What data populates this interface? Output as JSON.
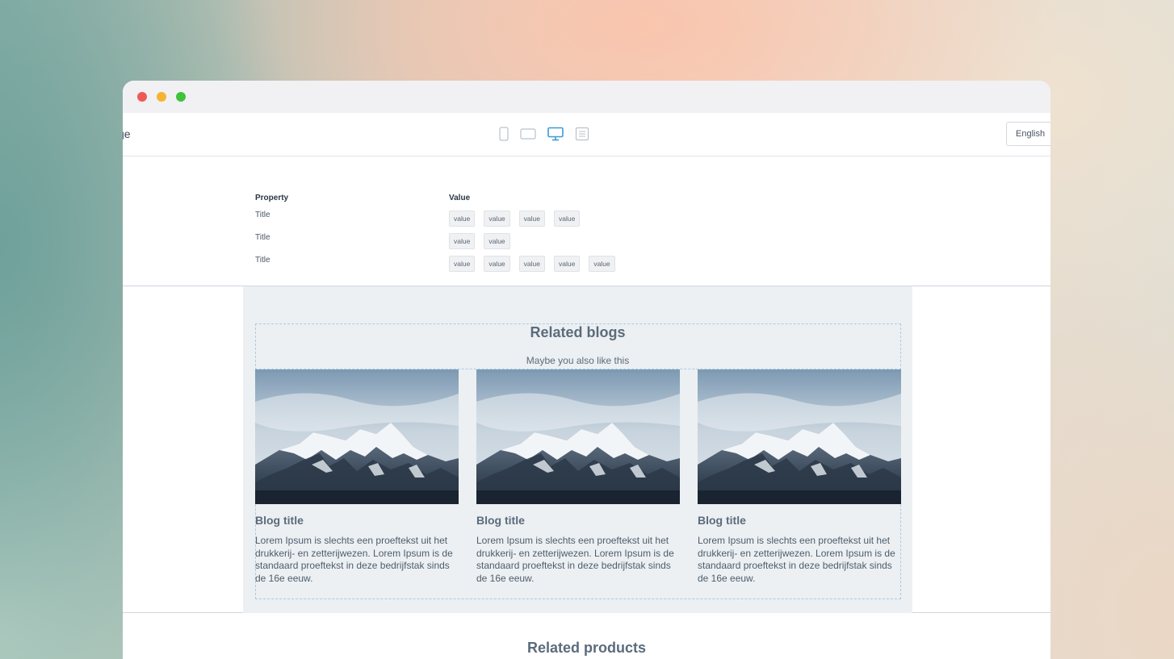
{
  "window": {
    "controls": [
      "close",
      "minimize",
      "maximize"
    ]
  },
  "toolbar": {
    "page_label": "ge",
    "devices": [
      {
        "name": "mobile-icon",
        "active": false
      },
      {
        "name": "tablet-icon",
        "active": false
      },
      {
        "name": "desktop-icon",
        "active": true
      },
      {
        "name": "document-icon",
        "active": false
      }
    ],
    "language": "English"
  },
  "properties": {
    "headers": {
      "property": "Property",
      "value": "Value"
    },
    "rows": [
      {
        "title": "Title",
        "values": [
          "value",
          "value",
          "value",
          "value"
        ]
      },
      {
        "title": "Title",
        "values": [
          "value",
          "value"
        ]
      },
      {
        "title": "Title",
        "values": [
          "value",
          "value",
          "value",
          "value",
          "value"
        ]
      }
    ]
  },
  "related_blogs": {
    "title": "Related blogs",
    "subtitle": "Maybe you also like this",
    "cards": [
      {
        "title": "Blog title",
        "body": "Lorem Ipsum is slechts een proeftekst uit het drukkerij- en zetterijwezen. Lorem Ipsum is de standaard proeftekst in deze bedrijfstak sinds de 16e eeuw."
      },
      {
        "title": "Blog title",
        "body": "Lorem Ipsum is slechts een proeftekst uit het drukkerij- en zetterijwezen. Lorem Ipsum is de standaard proeftekst in deze bedrijfstak sinds de 16e eeuw."
      },
      {
        "title": "Blog title",
        "body": "Lorem Ipsum is slechts een proeftekst uit het drukkerij- en zetterijwezen. Lorem Ipsum is de standaard proeftekst in deze bedrijfstak sinds de 16e eeuw."
      }
    ]
  },
  "related_products": {
    "title": "Related products"
  },
  "colors": {
    "accent": "#3d9bd6",
    "dot_red": "#ee5b55",
    "dot_yellow": "#f5b431",
    "dot_green": "#3fc33b"
  }
}
